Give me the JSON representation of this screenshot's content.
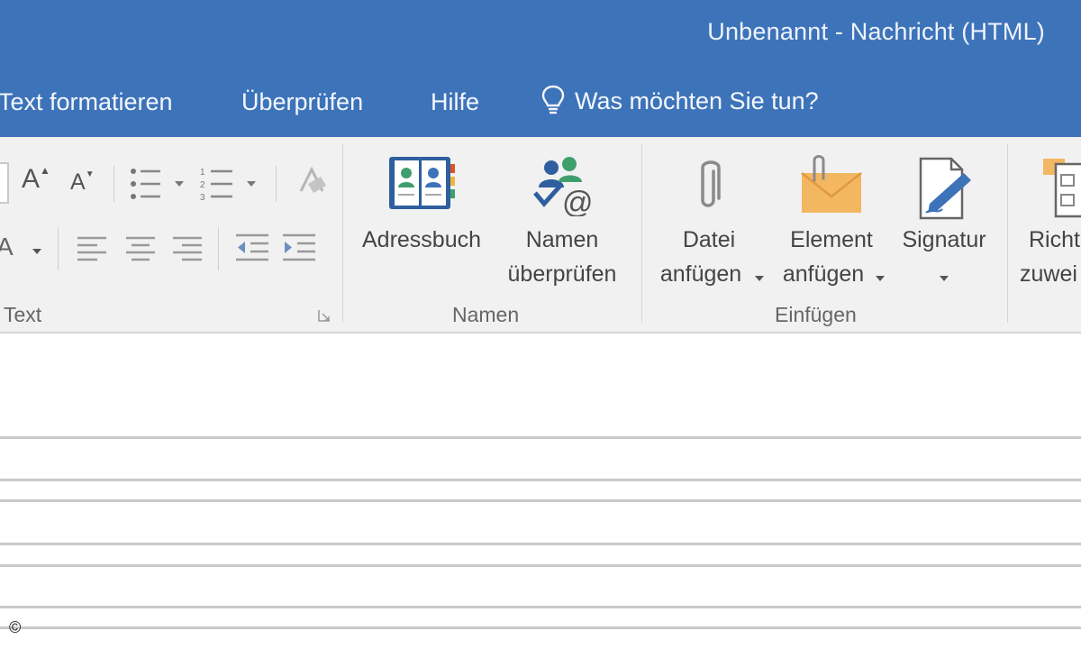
{
  "window": {
    "title": "Unbenannt  -  Nachricht (HTML)"
  },
  "menu": {
    "items": [
      "Text formatieren",
      "Überprüfen",
      "Hilfe"
    ],
    "tell_me": "Was möchten Sie tun?"
  },
  "ribbon": {
    "groups": {
      "text": "Text",
      "namen": "Namen",
      "einfuegen": "Einfügen"
    },
    "buttons": {
      "adressbuch": "Adressbuch",
      "namen_pruefen": [
        "Namen",
        "überprüfen"
      ],
      "datei_anfuegen": [
        "Datei",
        "anfügen"
      ],
      "element_anfuegen": [
        "Element",
        "anfügen"
      ],
      "signatur": "Signatur",
      "richtlinie": [
        "Richt",
        "zuwei"
      ]
    },
    "small_labels": {
      "font_grow": "A",
      "font_shrink": "A",
      "font_color": "A"
    }
  },
  "footer": {
    "copyright": "©"
  },
  "colors": {
    "titlebar": "#3d73b9",
    "ribbon_bg": "#f1f1f1",
    "envelope": "#f3b661"
  }
}
